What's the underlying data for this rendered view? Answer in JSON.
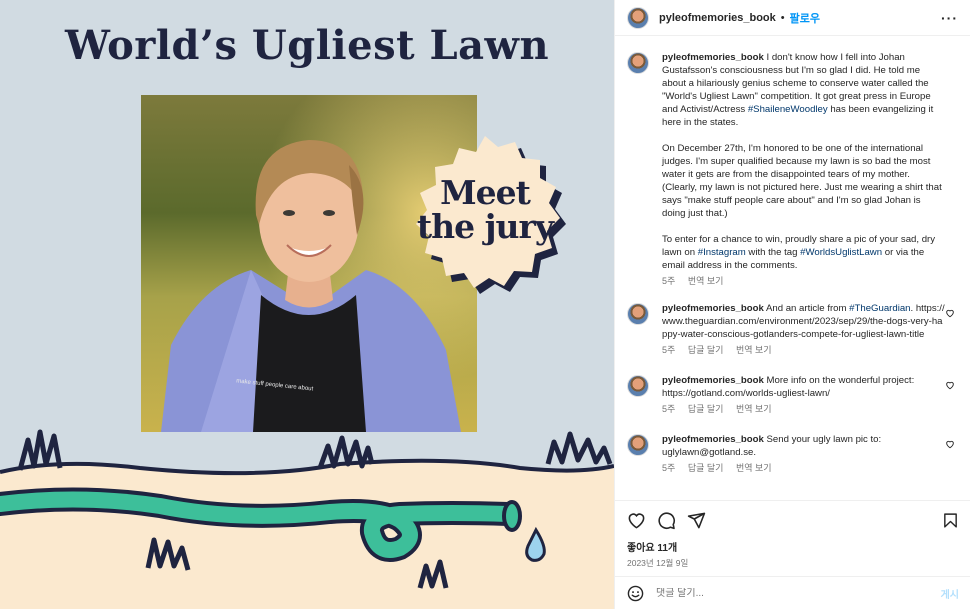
{
  "post_image": {
    "title": "World’s Ugliest Lawn",
    "badge_line1": "Meet",
    "badge_line2": "the jury",
    "shirt_text": "make stuff people care about"
  },
  "header": {
    "username": "pyleofmemories_book",
    "separator": "•",
    "follow_label": "팔로우",
    "more_label": "···"
  },
  "caption": {
    "username": "pyleofmemories_book",
    "p1_a": "I don't know how I fell into Johan Gustafsson's consciousness but I'm so glad I did. He told me about a hilariously genius scheme to conserve water called the \"World's Ugliest Lawn\" competition. It got great press in Europe and Activist/Actress ",
    "p1_tag": "#ShaileneWoodley",
    "p1_b": " has been evangelizing it here in the states.",
    "p2": "On December 27th, I'm honored to be one of the international judges. I'm super qualified because my lawn is so bad the most water it gets are from the disappointed tears of my mother. (Clearly, my lawn is not pictured here. Just me wearing a shirt that says \"make stuff people care about\" and I'm so glad Johan is doing just that.)",
    "p3_a": "To enter for a chance to win, proudly share a pic of your sad, dry lawn on ",
    "p3_tag1": "#Instagram",
    "p3_b": " with the tag ",
    "p3_tag2": "#WorldsUglistLawn",
    "p3_c": " or via the email address in the comments.",
    "time": "5주",
    "translate": "번역 보기"
  },
  "comments": [
    {
      "username": "pyleofmemories_book",
      "text_a": "And an article from ",
      "tag": "#TheGuardian",
      "text_b": ". https://www.theguardian.com/environment/2023/sep/29/the-dogs-very-happy-water-conscious-gotlanders-compete-for-ugliest-lawn-title",
      "time": "5주",
      "reply": "답글 달기",
      "translate": "번역 보기"
    },
    {
      "username": "pyleofmemories_book",
      "text_a": "More info on the wonderful project: https://gotland.com/worlds-ugliest-lawn/",
      "tag": "",
      "text_b": "",
      "time": "5주",
      "reply": "답글 달기",
      "translate": "번역 보기"
    },
    {
      "username": "pyleofmemories_book",
      "text_a": "Send your ugly lawn pic to: uglylawn@gotland.se.",
      "tag": "",
      "text_b": "",
      "time": "5주",
      "reply": "답글 달기",
      "translate": "번역 보기"
    }
  ],
  "actions": {
    "likes": "좋아요 11개",
    "date": "2023년 12월 9일"
  },
  "add_comment": {
    "placeholder": "댓글 달기...",
    "post_label": "게시"
  },
  "colors": {
    "follow_blue": "#0095f6",
    "tag_blue": "#00376b",
    "title_navy": "#1f2440",
    "hose_green": "#3dbf9a",
    "cream": "#fbe9cf",
    "panel_bg": "#d1dbe2"
  }
}
